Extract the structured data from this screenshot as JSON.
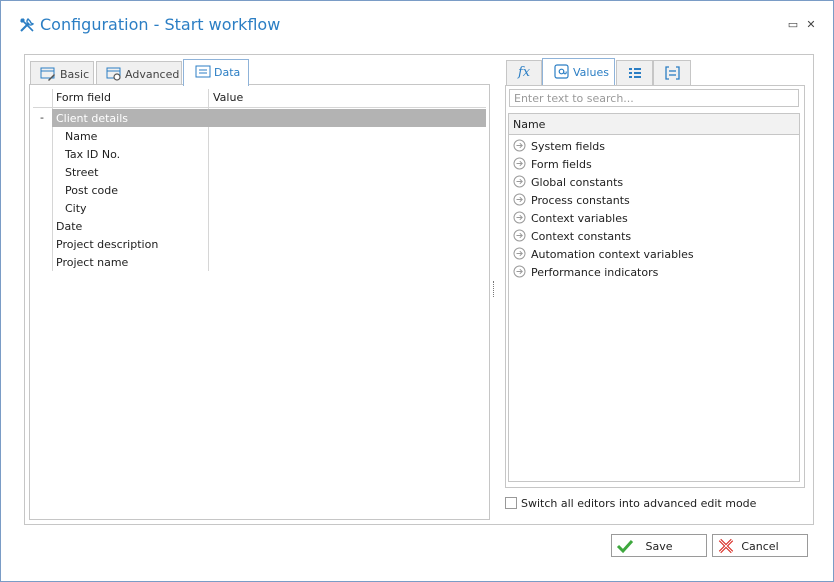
{
  "window": {
    "title": "Configuration - Start workflow",
    "minimize_label": "▭",
    "close_label": "✕"
  },
  "left_tabs": [
    {
      "label": "Basic",
      "icon": "form-pencil-icon",
      "active": false
    },
    {
      "label": "Advanced",
      "icon": "form-gear-icon",
      "active": false
    },
    {
      "label": "Data",
      "icon": "data-list-icon",
      "active": true
    }
  ],
  "grid": {
    "columns": [
      "Form field",
      "Value"
    ],
    "collapse_symbol": "-",
    "rows": [
      {
        "label": "Client details",
        "level": 0,
        "selected": true
      },
      {
        "label": "Name",
        "level": 1,
        "selected": false
      },
      {
        "label": "Tax ID No.",
        "level": 1,
        "selected": false
      },
      {
        "label": "Street",
        "level": 1,
        "selected": false
      },
      {
        "label": "Post code",
        "level": 1,
        "selected": false
      },
      {
        "label": "City",
        "level": 1,
        "selected": false
      },
      {
        "label": "Date",
        "level": 0,
        "selected": false
      },
      {
        "label": "Project description",
        "level": 0,
        "selected": false
      },
      {
        "label": "Project name",
        "level": 0,
        "selected": false
      }
    ]
  },
  "right_tabs": [
    {
      "label": "",
      "icon": "function-fx-icon",
      "active": false
    },
    {
      "label": "Values",
      "icon": "at-sign-icon",
      "active": true
    },
    {
      "label": "",
      "icon": "list-icon",
      "active": false
    },
    {
      "label": "",
      "icon": "bracket-list-icon",
      "active": false
    }
  ],
  "values_panel": {
    "search_placeholder": "Enter text to search...",
    "search_value": "",
    "header": "Name",
    "items": [
      "System fields",
      "Form fields",
      "Global constants",
      "Process constants",
      "Context variables",
      "Context constants",
      "Automation context variables",
      "Performance indicators"
    ]
  },
  "advanced_mode": {
    "label": "Switch all editors into advanced edit mode",
    "checked": false
  },
  "buttons": {
    "save_label": "Save",
    "cancel_label": "Cancel"
  },
  "colors": {
    "accent": "#2b7ec4",
    "selected_row": "#b3b3b3",
    "save_icon": "#3ea83e",
    "cancel_icon": "#d7261e"
  }
}
